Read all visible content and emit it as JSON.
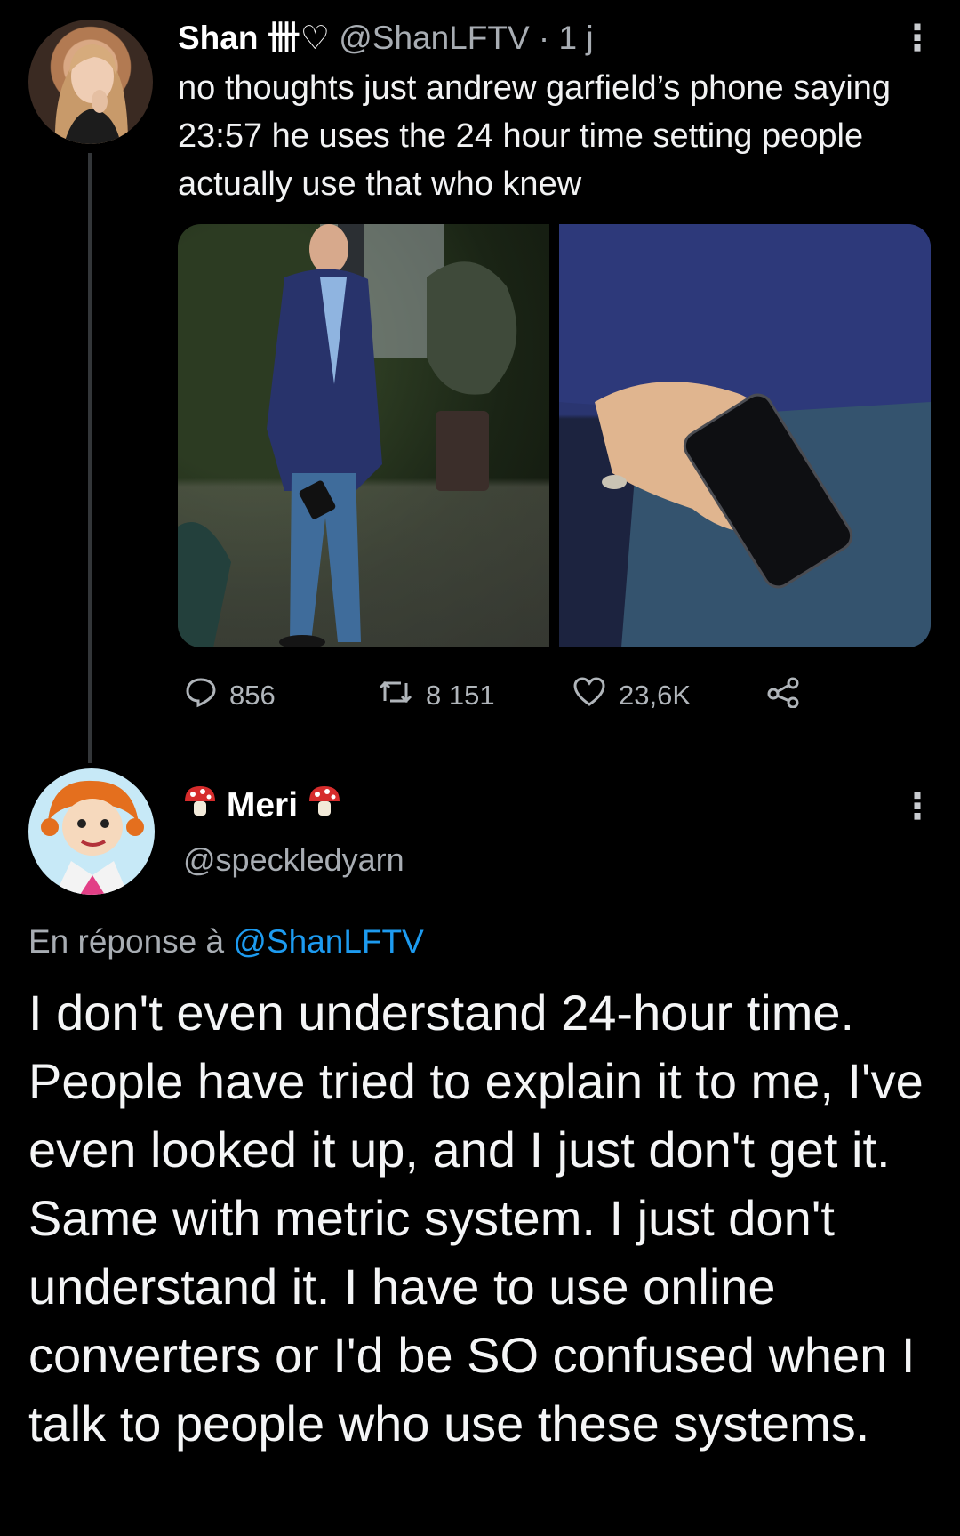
{
  "tweet": {
    "author_name": "Shan",
    "author_decoration": "卌♡",
    "handle": "@ShanLFTV",
    "time": "· 1 j",
    "text": "no thoughts just andrew garfield’s phone saying 23:57 he uses the 24 hour time setting people actually use that who knew",
    "replies": "856",
    "retweets": "8 151",
    "likes": "23,6K"
  },
  "reply": {
    "author_name": "Meri",
    "handle": "@speckledyarn",
    "reply_prefix": "En réponse à",
    "reply_mention": "@ShanLFTV",
    "text": "I don't even understand 24-hour time. People have tried to explain it to me, I've even looked it up, and I just don't get it. Same with metric system. I just don't understand it. I have to use online converters or I'd be SO confused when I talk to people who use these systems."
  },
  "icons": {
    "more": "more-vertical-icon",
    "reply": "reply-icon",
    "retweet": "retweet-icon",
    "like": "heart-icon",
    "share": "share-icon",
    "mushroom": "mushroom-icon"
  },
  "colors": {
    "background": "#000000",
    "text": "#e7e9ea",
    "muted": "#a8adb3",
    "mention": "#1d9bf0",
    "mushroom_red": "#d62c2c"
  }
}
